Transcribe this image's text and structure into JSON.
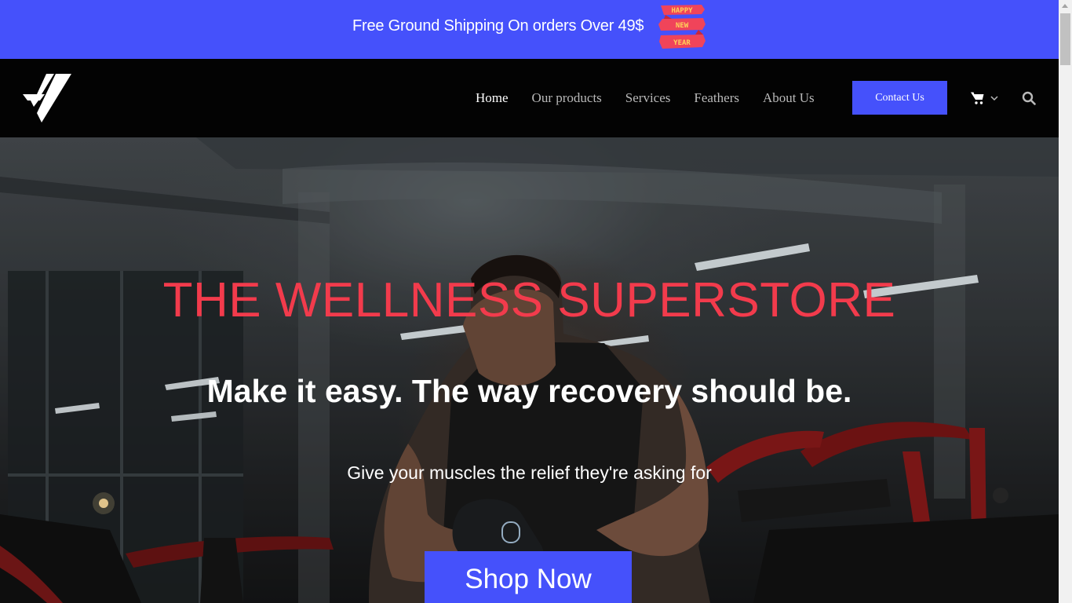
{
  "promo": {
    "text": "Free Ground Shipping On orders Over 49$",
    "badge_lines": [
      "HAPPY",
      "NEW",
      "YEAR"
    ]
  },
  "header": {
    "logo_icon": "brand-logo",
    "nav": [
      {
        "label": "Home",
        "active": true
      },
      {
        "label": "Our products",
        "active": false
      },
      {
        "label": "Services",
        "active": false
      },
      {
        "label": "Feathers",
        "active": false
      },
      {
        "label": "About Us",
        "active": false
      }
    ],
    "contact_label": "Contact Us",
    "cart_icon": "shopping-cart-icon",
    "search_icon": "search-icon"
  },
  "hero": {
    "title": "THE WELLNESS SUPERSTORE",
    "subtitle": "Make it easy. The way recovery should be.",
    "tagline": "Give your muscles the relief they're asking for",
    "cta_label": "Shop Now"
  },
  "colors": {
    "accent": "#4551fb",
    "title_red": "#f23b4c",
    "header_bg": "#030303"
  }
}
